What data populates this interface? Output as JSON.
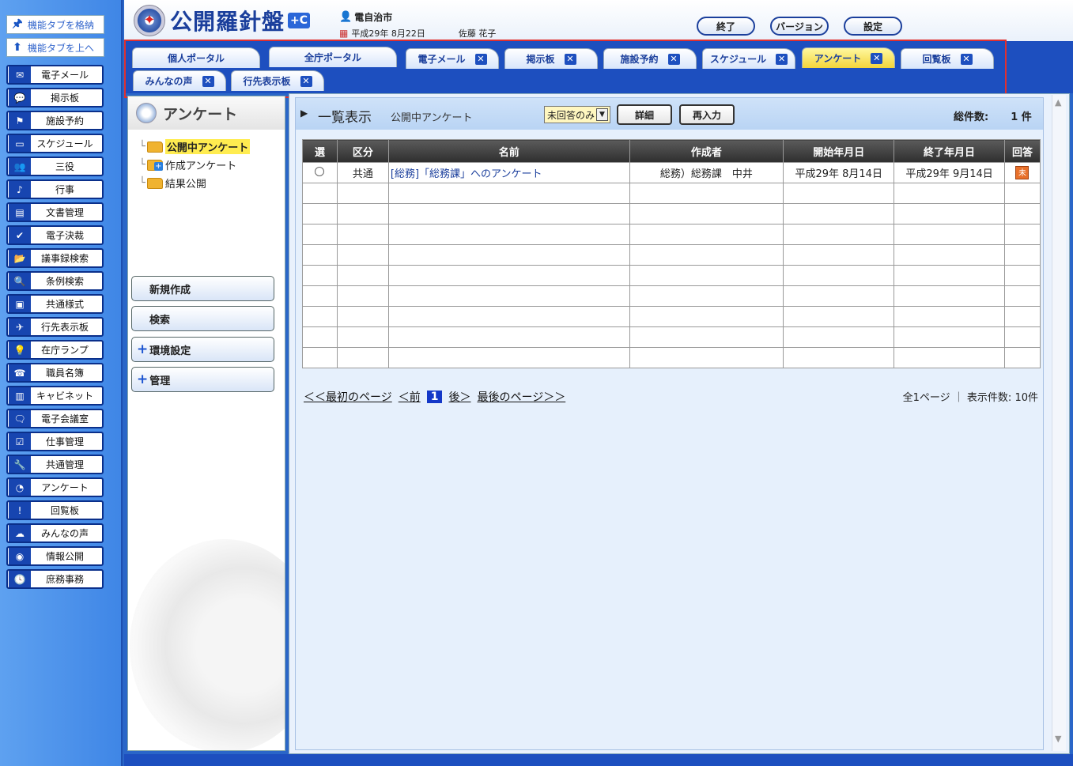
{
  "leftbar": {
    "top_buttons": [
      {
        "label": "機能タブを格納",
        "icon": "pin-icon"
      },
      {
        "label": "機能タブを上へ",
        "icon": "arrow-up-icon"
      }
    ],
    "items": [
      {
        "label": "電子メール",
        "icon": "mail-icon",
        "glyph": "✉"
      },
      {
        "label": "掲示板",
        "icon": "speech-bubble-icon",
        "glyph": "💬"
      },
      {
        "label": "施設予約",
        "icon": "flag-icon",
        "glyph": "⚑"
      },
      {
        "label": "スケジュール",
        "icon": "window-icon",
        "glyph": "▭"
      },
      {
        "label": "三役",
        "icon": "people-icon",
        "glyph": "👥"
      },
      {
        "label": "行事",
        "icon": "music-note-icon",
        "glyph": "♪"
      },
      {
        "label": "文書管理",
        "icon": "document-icon",
        "glyph": "▤"
      },
      {
        "label": "電子決裁",
        "icon": "check-icon",
        "glyph": "✔"
      },
      {
        "label": "議事録検索",
        "icon": "folder-open-icon",
        "glyph": "📂"
      },
      {
        "label": "条例検索",
        "icon": "magnifier-icon",
        "glyph": "🔍"
      },
      {
        "label": "共通様式",
        "icon": "form-icon",
        "glyph": "▣"
      },
      {
        "label": "行先表示板",
        "icon": "airplane-icon",
        "glyph": "✈"
      },
      {
        "label": "在庁ランプ",
        "icon": "lightbulb-icon",
        "glyph": "💡"
      },
      {
        "label": "職員名簿",
        "icon": "phone-icon",
        "glyph": "☎"
      },
      {
        "label": "キャビネット",
        "icon": "cabinet-icon",
        "glyph": "▥"
      },
      {
        "label": "電子会議室",
        "icon": "chat-icon",
        "glyph": "🗨"
      },
      {
        "label": "仕事管理",
        "icon": "checklist-icon",
        "glyph": "☑"
      },
      {
        "label": "共通管理",
        "icon": "wrench-icon",
        "glyph": "🔧"
      },
      {
        "label": "アンケート",
        "icon": "survey-icon",
        "glyph": "◔"
      },
      {
        "label": "回覧板",
        "icon": "exclamation-icon",
        "glyph": "!"
      },
      {
        "label": "みんなの声",
        "icon": "voice-icon",
        "glyph": "☁"
      },
      {
        "label": "情報公開",
        "icon": "broadcast-icon",
        "glyph": "◉"
      },
      {
        "label": "庶務事務",
        "icon": "clock-icon",
        "glyph": "🕓"
      }
    ]
  },
  "header": {
    "app_name": "公開羅針盤",
    "badge": "+C",
    "org": "電自治市",
    "date": "平成29年 8月22日",
    "user": "佐藤 花子",
    "buttons": {
      "exit": "終了",
      "version": "バージョン",
      "settings": "設定"
    }
  },
  "tabs": [
    {
      "label": "個人ポータル",
      "closable": false
    },
    {
      "label": "全庁ポータル",
      "closable": false
    },
    {
      "label": "電子メール",
      "closable": true
    },
    {
      "label": "掲示板",
      "closable": true
    },
    {
      "label": "施設予約",
      "closable": true
    },
    {
      "label": "スケジュール",
      "closable": true
    },
    {
      "label": "アンケート",
      "closable": true,
      "active": true
    },
    {
      "label": "回覧板",
      "closable": true
    },
    {
      "label": "みんなの声",
      "closable": true
    },
    {
      "label": "行先表示板",
      "closable": true
    }
  ],
  "leftpanel": {
    "title": "アンケート",
    "tree": [
      {
        "label": "公開中アンケート",
        "selected": true
      },
      {
        "label": "作成アンケート"
      },
      {
        "label": "結果公開"
      }
    ],
    "buttons": {
      "new": "新規作成",
      "search": "検索",
      "env": "環境設定",
      "admin": "管理"
    }
  },
  "main": {
    "title": "一覧表示",
    "subtitle": "公開中アンケート",
    "filter_value": "未回答のみ",
    "btn_detail": "詳細",
    "btn_reenter": "再入力",
    "total_label": "総件数:",
    "total_value": "1 件",
    "columns": [
      "選",
      "区分",
      "名前",
      "作成者",
      "開始年月日",
      "終了年月日",
      "回答"
    ],
    "rows": [
      {
        "category": "共通",
        "name": "[総務]「総務課」へのアンケート",
        "creator": "総務）総務課　中井",
        "start": "平成29年 8月14日",
        "end": "平成29年 9月14日",
        "answer": "未"
      }
    ],
    "pager": {
      "first": "＜＜最初のページ",
      "prev": "＜前",
      "current": "1",
      "next": "後＞",
      "last": "最後のページ＞＞",
      "info": "全1ページ ｜ 表示件数: 10件"
    }
  },
  "colors": {
    "accent": "#1d4fbf",
    "active_tab": "#f3d43a",
    "highlight": "#ffec50"
  }
}
